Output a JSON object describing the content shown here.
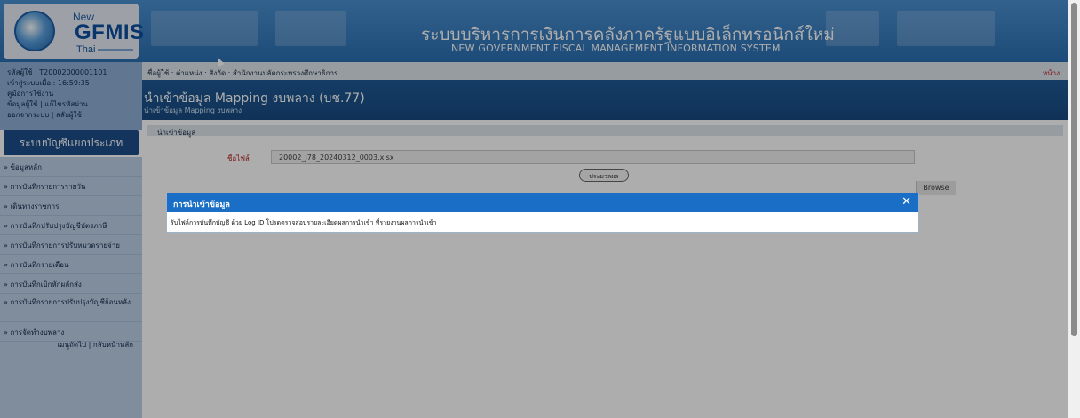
{
  "header": {
    "logo": {
      "line1": "New",
      "line2": "GFMIS",
      "line3": "Thai"
    },
    "title_th": "ระบบบริหารการเงินการคลังภาครัฐแบบอิเล็กทรอนิกส์ใหม่",
    "title_en": "NEW GOVERNMENT FISCAL MANAGEMENT INFORMATION SYSTEM"
  },
  "user_panel": {
    "user_code": "รหัสผู้ใช้ : T20002000001101",
    "login_time": "เข้าสู่ระบบเมื่อ : 16:59:35",
    "manual": "คู่มือการใช้งาน",
    "profile": "ข้อมูลผู้ใช้",
    "separator": "|",
    "edit_password": "แก้ไขรหัสผ่าน",
    "logout": "ออกจากระบบ",
    "switch_user": "สลับผู้ใช้"
  },
  "sidebar": {
    "system_title": "ระบบบัญชีแยกประเภท",
    "items": [
      {
        "label": "» ข้อมูลหลัก"
      },
      {
        "label": "» การบันทึกรายการรายวัน"
      },
      {
        "label": "» เดินทางราชการ"
      },
      {
        "label": "» การบันทึกปรับปรุงบัญชีบัตรภาษี"
      },
      {
        "label": "» การบันทึกรายการปรับหมวดรายจ่าย"
      },
      {
        "label": "» การบันทึกรายเดือน"
      },
      {
        "label": "» การบันทึกเบิกหักผลักส่ง"
      },
      {
        "label": "» การบันทึกรายการปรับปรุงบัญชีย้อนหลัง"
      },
      {
        "label": "» การจัดทำงบพลาง"
      }
    ],
    "footer": "เมนูถัดไป | กลับหน้าหลัก"
  },
  "breadcrumb": {
    "text": "ชื่อผู้ใช้ :    ตำแหน่ง :    สังกัด : สำนักงานปลัดกระทรวงศึกษาธิการ",
    "right": "หน้าง"
  },
  "page": {
    "title": "นำเข้าข้อมูล Mapping งบพลาง (บช.77)",
    "subtitle": "นำเข้าข้อมูล Mapping งบพลาง",
    "section": "นำเข้าข้อมูล",
    "file_label": "ชื่อไฟล์",
    "file_value": "20002_J78_20240312_0003.xlsx",
    "browse": "Browse",
    "process": "ประมวลผล"
  },
  "modal": {
    "title": "การนำเข้าข้อมูล",
    "message": "รับไฟล์การบันทึกบัญชี ด้วย Log ID โปรดตรวจสอบรายละเอียดผลการนำเข้า ที่รายงานผลการนำเข้า",
    "close_glyph": "✕"
  },
  "colors": {
    "header_blue": "#2c6fb2",
    "modal_header": "#1a6ec6",
    "alert_red": "#b42020"
  }
}
